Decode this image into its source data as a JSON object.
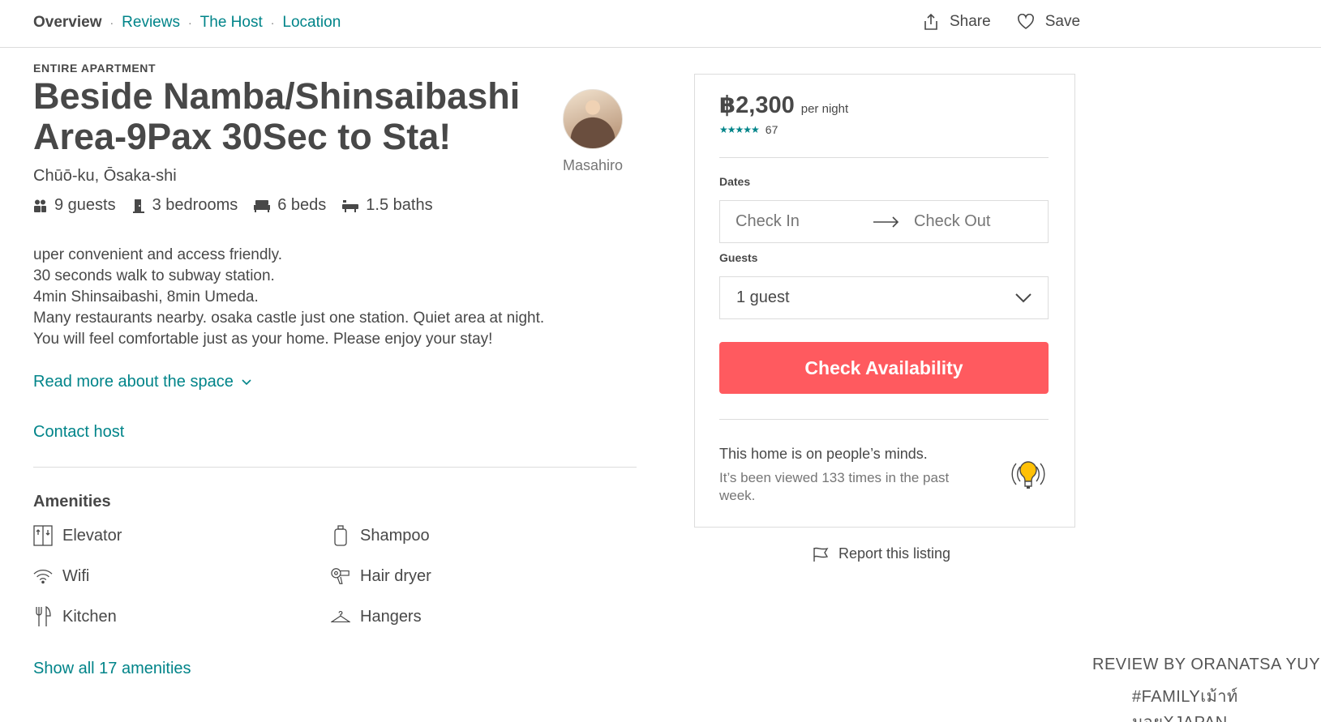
{
  "nav": {
    "overview": "Overview",
    "reviews": "Reviews",
    "host": "The Host",
    "location": "Location",
    "separator": "·",
    "share": "Share",
    "save": "Save"
  },
  "listing": {
    "kind": "ENTIRE APARTMENT",
    "title": "Beside Namba/Shinsaibashi Area-9Pax 30Sec to Sta!",
    "locality": "Chūō-ku, Ōsaka-shi",
    "host_name": "Masahiro",
    "facts": {
      "guests": "9 guests",
      "bedrooms": "3 bedrooms",
      "beds": "6 beds",
      "baths": "1.5 baths"
    },
    "description": [
      "uper convenient and access friendly.",
      "30 seconds walk to subway station.",
      "4min Shinsaibashi, 8min Umeda.",
      "Many restaurants nearby. osaka castle just one station. Quiet area at night.",
      "You will feel comfortable just as your home. Please enjoy your stay!"
    ],
    "read_more": "Read more about the space",
    "contact_host": "Contact host"
  },
  "amenities": {
    "title": "Amenities",
    "items": {
      "elevator": "Elevator",
      "shampoo": "Shampoo",
      "wifi": "Wifi",
      "hair_dryer": "Hair dryer",
      "kitchen": "Kitchen",
      "hangers": "Hangers"
    },
    "show_all": "Show all 17 amenities"
  },
  "booking": {
    "price": "฿2,300",
    "per_night": "per night",
    "rating_stars": "★★★★★",
    "review_count": "67",
    "dates_label": "Dates",
    "check_in_placeholder": "Check In",
    "check_out_placeholder": "Check Out",
    "guests_label": "Guests",
    "guests_value": "1 guest",
    "cta": "Check Availability",
    "minds_title": "This home is on people’s minds.",
    "minds_sub": "It’s been viewed 133 times in the past week."
  },
  "report": "Report this listing",
  "watermark": {
    "line1": "REVIEW BY ORANATSA YUY",
    "line2": "#FAMILYเม้าท์มอยXJAPAN"
  },
  "colors": {
    "accent_teal": "#008489",
    "cta_red": "#ff5a5f",
    "text": "#484848"
  }
}
